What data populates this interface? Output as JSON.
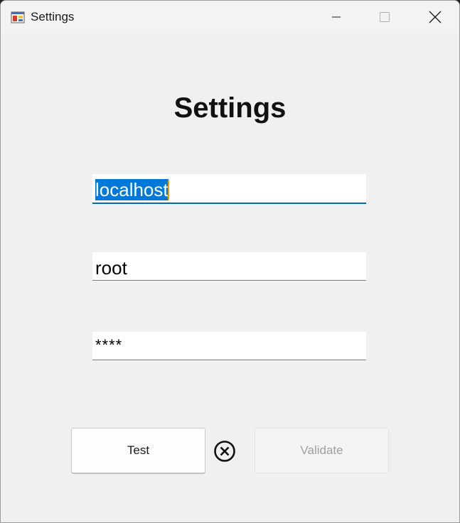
{
  "window": {
    "title": "Settings",
    "icon": "app-window-icon",
    "controls": [
      "minimize-icon",
      "maximize-icon",
      "close-icon"
    ]
  },
  "form": {
    "heading": "Settings",
    "host": {
      "value": "localhost",
      "selected": true,
      "focused": true
    },
    "user": {
      "value": "root"
    },
    "password": {
      "value": "****"
    }
  },
  "buttons": {
    "test_label": "Test",
    "validate_label": "Validate",
    "validate_enabled": false
  },
  "status": {
    "icon": "error-circle-x-icon"
  },
  "colors": {
    "selection": "#0078d7",
    "focus_underline": "#0067c0",
    "background": "#f0f0f0"
  }
}
